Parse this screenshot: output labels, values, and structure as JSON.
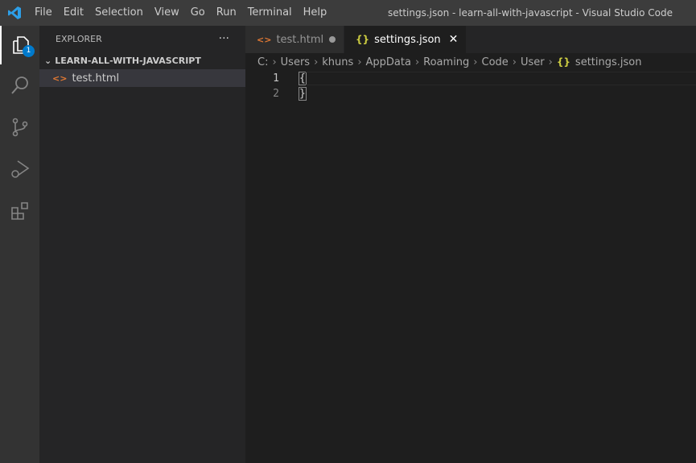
{
  "title_bar": {
    "menu": [
      "File",
      "Edit",
      "Selection",
      "View",
      "Go",
      "Run",
      "Terminal",
      "Help"
    ],
    "window_title": "settings.json - learn-all-with-javascript - Visual Studio Code"
  },
  "activity_bar": {
    "explorer_badge": "1"
  },
  "sidebar": {
    "title": "EXPLORER",
    "more": "···",
    "folder": "LEARN-ALL-WITH-JAVASCRIPT",
    "files": [
      "test.html"
    ]
  },
  "tabs": [
    {
      "label": "test.html",
      "state": "modified"
    },
    {
      "label": "settings.json",
      "state": "active"
    }
  ],
  "breadcrumb": [
    "C:",
    "Users",
    "khuns",
    "AppData",
    "Roaming",
    "Code",
    "User",
    "settings.json"
  ],
  "editor": {
    "lines": [
      {
        "num": "1",
        "text": "{"
      },
      {
        "num": "2",
        "text": "}"
      }
    ]
  },
  "colors": {
    "accent": "#007acc",
    "html_icon": "#e37933",
    "json_icon": "#cbcb41"
  }
}
